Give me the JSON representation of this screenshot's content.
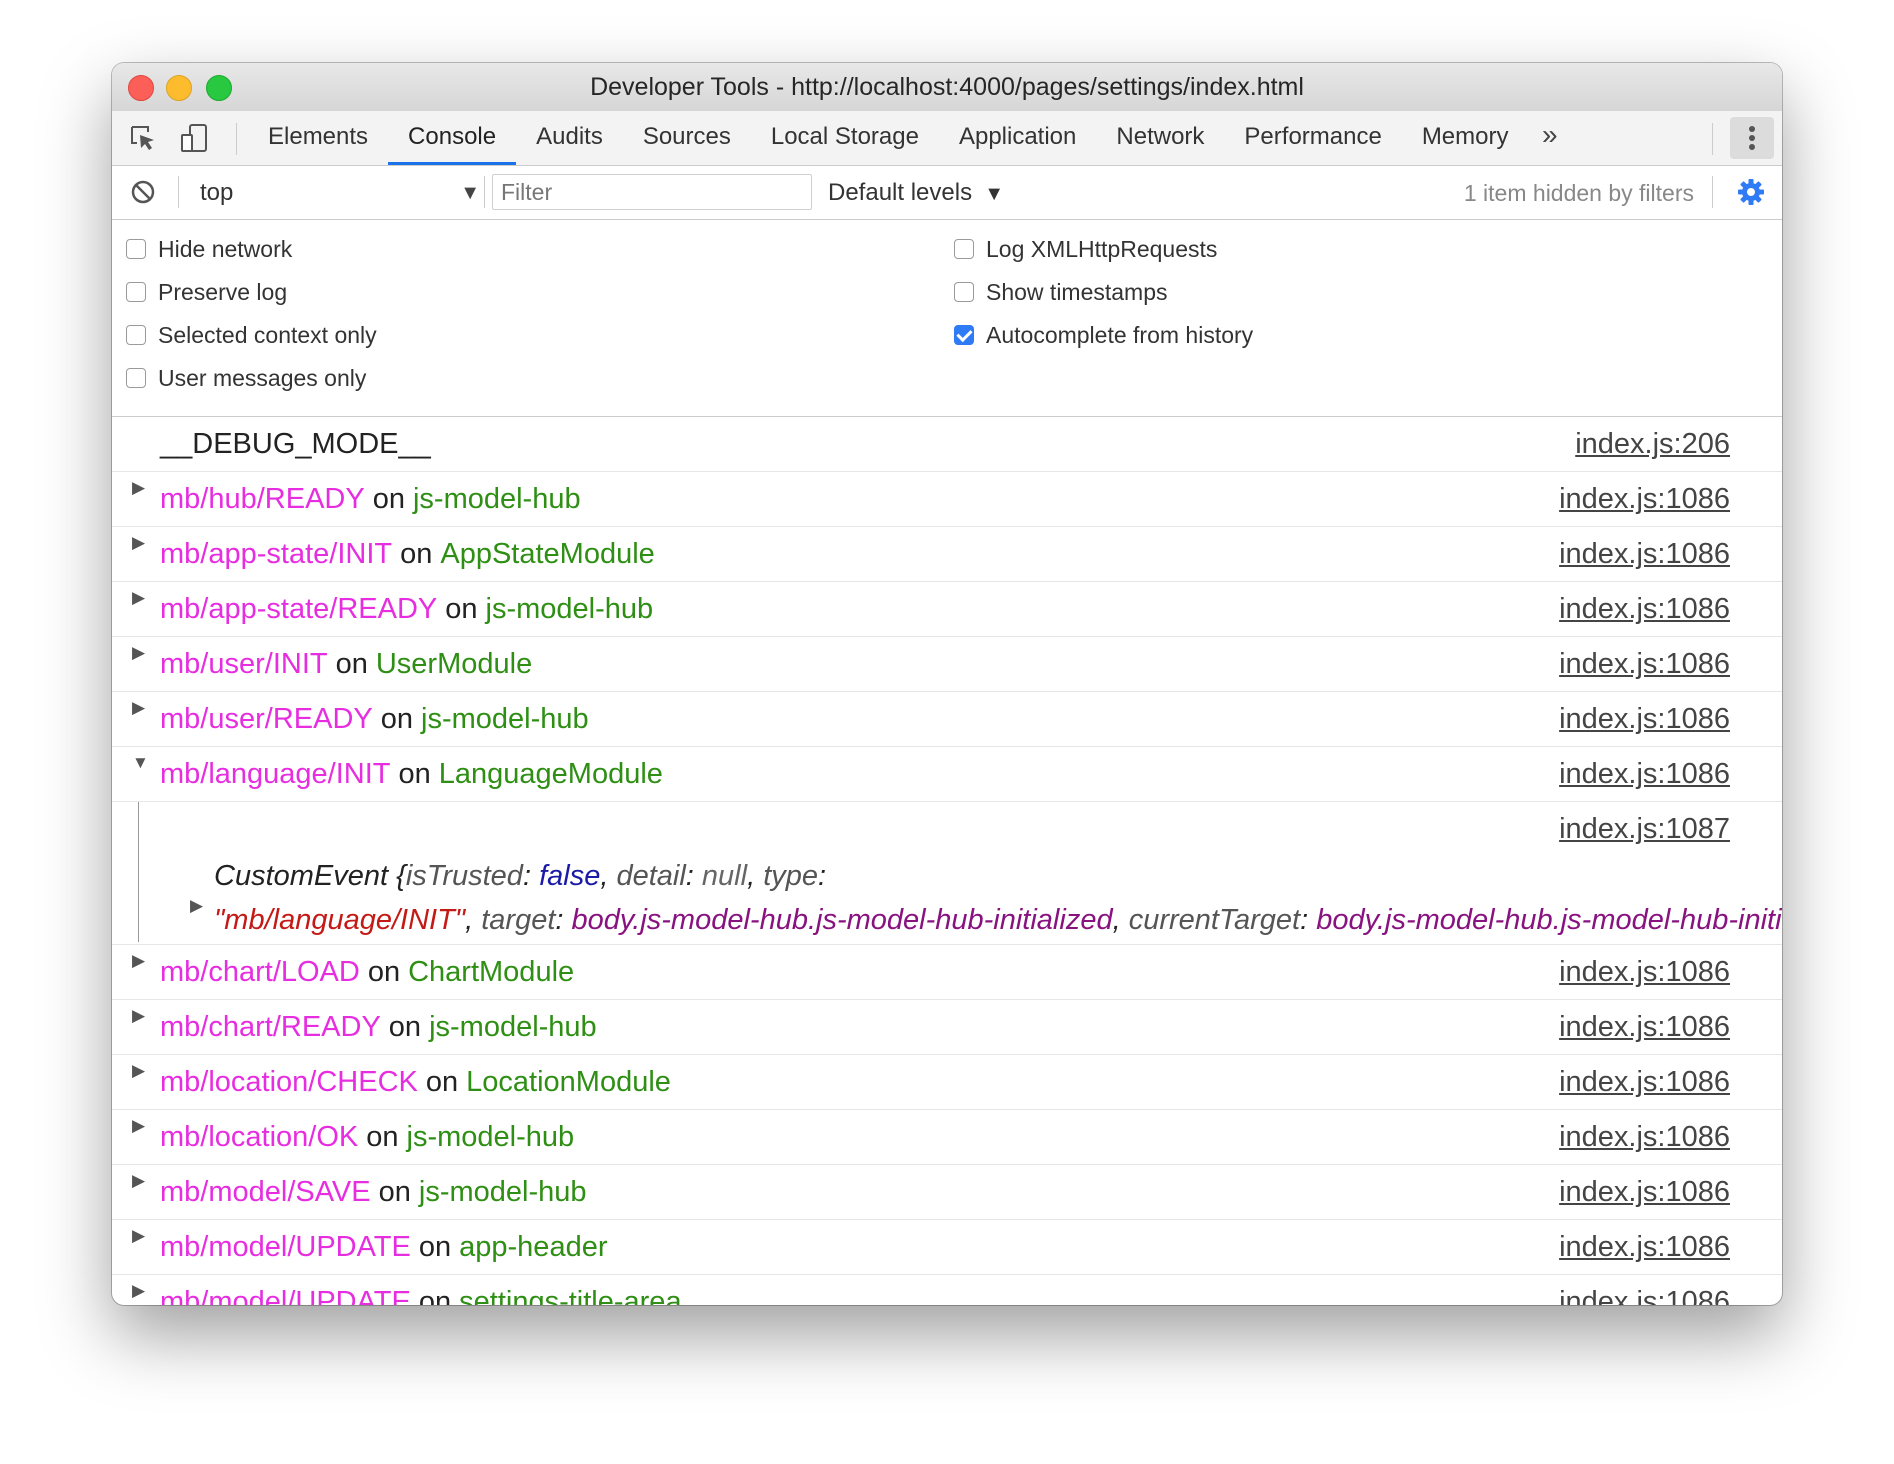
{
  "window": {
    "title": "Developer Tools - http://localhost:4000/pages/settings/index.html"
  },
  "tabs": [
    "Elements",
    "Console",
    "Audits",
    "Sources",
    "Local Storage",
    "Application",
    "Network",
    "Performance",
    "Memory"
  ],
  "active_tab": "Console",
  "toolbar": {
    "more_tabs": "»"
  },
  "filterbar": {
    "context": "top",
    "filter_placeholder": "Filter",
    "levels": "Default levels",
    "hidden_note": "1 item hidden by filters"
  },
  "settings": {
    "left": [
      {
        "label": "Hide network",
        "checked": false
      },
      {
        "label": "Preserve log",
        "checked": false
      },
      {
        "label": "Selected context only",
        "checked": false
      },
      {
        "label": "User messages only",
        "checked": false
      }
    ],
    "right": [
      {
        "label": "Log XMLHttpRequests",
        "checked": false
      },
      {
        "label": "Show timestamps",
        "checked": false
      },
      {
        "label": "Autocomplete from history",
        "checked": true
      }
    ]
  },
  "log": {
    "first": {
      "text": "__DEBUG_MODE__",
      "source": "index.js:206"
    },
    "connector": "on",
    "before": [
      {
        "event": "mb/hub/READY",
        "target": "js-model-hub",
        "source": "index.js:1086"
      },
      {
        "event": "mb/app-state/INIT",
        "target": "AppStateModule",
        "source": "index.js:1086"
      },
      {
        "event": "mb/app-state/READY",
        "target": "js-model-hub",
        "source": "index.js:1086"
      },
      {
        "event": "mb/user/INIT",
        "target": "UserModule",
        "source": "index.js:1086"
      },
      {
        "event": "mb/user/READY",
        "target": "js-model-hub",
        "source": "index.js:1086"
      }
    ],
    "expanded": {
      "event": "mb/language/INIT",
      "target": "LanguageModule",
      "source": "index.js:1086",
      "child_source": "index.js:1087",
      "object": {
        "name": "CustomEvent {",
        "k_trusted": "isTrusted",
        "v_trusted": "false",
        "k_detail": "detail",
        "v_detail": "null",
        "k_type": "type",
        "v_type": "\"mb/language/INIT\"",
        "k_target": "target",
        "v_target": "body.js-model-hub.js-model-hub-initialized",
        "k_current": "currentTarget",
        "v_current": "body.js-model-hub.js-model-hub-initialized"
      }
    },
    "after": [
      {
        "event": "mb/chart/LOAD",
        "target": "ChartModule",
        "source": "index.js:1086"
      },
      {
        "event": "mb/chart/READY",
        "target": "js-model-hub",
        "source": "index.js:1086"
      },
      {
        "event": "mb/location/CHECK",
        "target": "LocationModule",
        "source": "index.js:1086"
      },
      {
        "event": "mb/location/OK",
        "target": "js-model-hub",
        "source": "index.js:1086"
      },
      {
        "event": "mb/model/SAVE",
        "target": "js-model-hub",
        "source": "index.js:1086"
      },
      {
        "event": "mb/model/UPDATE",
        "target": "app-header",
        "source": "index.js:1086"
      },
      {
        "event": "mb/model/UPDATE",
        "target": "settings-title-area",
        "source": "index.js:1086"
      }
    ]
  },
  "colors": {
    "accent": "#1a73e8",
    "event": "#e62ee0",
    "module": "#2e8f14",
    "checkbox": "#2f7bf5"
  }
}
